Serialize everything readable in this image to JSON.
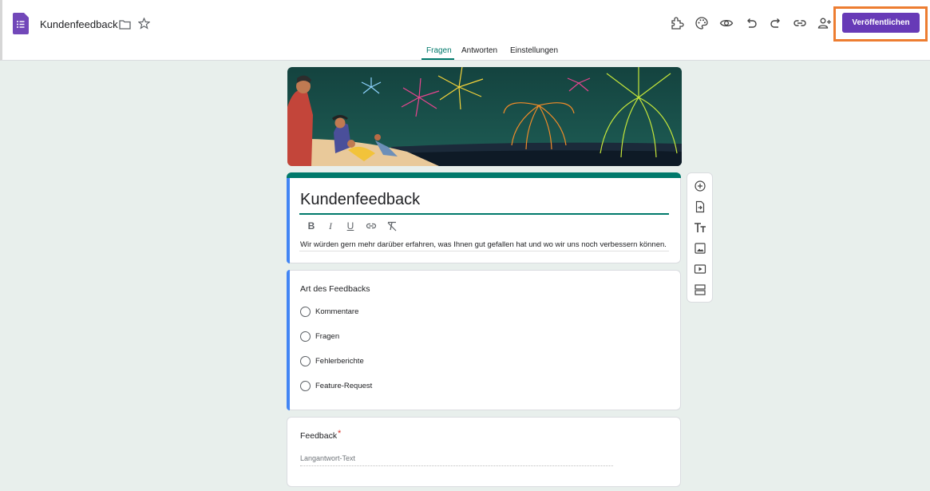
{
  "header": {
    "doc_title": "Kundenfeedback",
    "publish_label": "Veröffentlichen",
    "toolbar_icons": [
      "addons-icon",
      "palette-icon",
      "preview-icon",
      "undo-icon",
      "redo-icon",
      "link-icon",
      "add-collaborator-icon"
    ],
    "accent_color": "#673ab7",
    "highlight_color": "#ed7d31"
  },
  "tabs": [
    {
      "label": "Fragen",
      "active": true
    },
    {
      "label": "Antworten",
      "active": false
    },
    {
      "label": "Einstellungen",
      "active": false
    }
  ],
  "form": {
    "title": "Kundenfeedback",
    "description": "Wir würden gern mehr darüber erfahren, was Ihnen gut gefallen hat und wo wir uns noch verbessern können.",
    "format_buttons": [
      "B",
      "I",
      "U",
      "link-icon",
      "clear-format-icon"
    ]
  },
  "question1": {
    "title": "Art des Feedbacks",
    "options": [
      "Kommentare",
      "Fragen",
      "Fehlerberichte",
      "Feature-Request"
    ]
  },
  "question2": {
    "title": "Feedback",
    "required_mark": "*",
    "placeholder": "Langantwort-Text"
  },
  "side_tools": [
    "add-question-icon",
    "import-questions-icon",
    "add-title-icon",
    "add-image-icon",
    "add-video-icon",
    "add-section-icon"
  ],
  "theme_color": "#00796b"
}
